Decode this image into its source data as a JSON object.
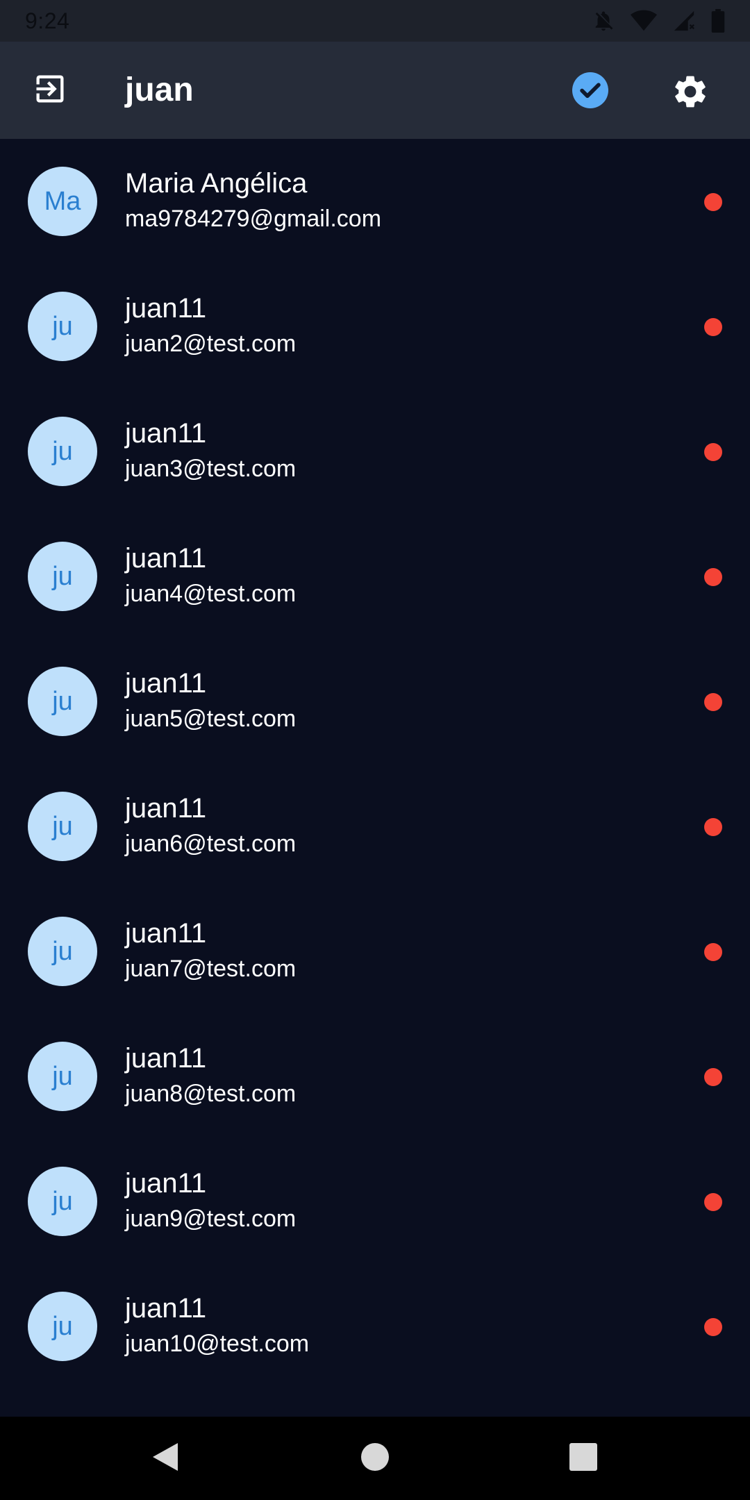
{
  "status_bar": {
    "time": "9:24",
    "icons": [
      "notifications-off-icon",
      "wifi-icon",
      "signal-icon",
      "battery-icon"
    ]
  },
  "app_bar": {
    "title": "juan",
    "left_icon": "logout-icon",
    "right_icons": [
      "verified-check-icon",
      "settings-gear-icon"
    ],
    "accent_color": "#5aabf5"
  },
  "contacts": [
    {
      "initials": "Ma",
      "name": "Maria Angélica",
      "email": "ma9784279@gmail.com",
      "status_color": "#f44336"
    },
    {
      "initials": "ju",
      "name": "juan11",
      "email": "juan2@test.com",
      "status_color": "#f44336"
    },
    {
      "initials": "ju",
      "name": "juan11",
      "email": "juan3@test.com",
      "status_color": "#f44336"
    },
    {
      "initials": "ju",
      "name": "juan11",
      "email": "juan4@test.com",
      "status_color": "#f44336"
    },
    {
      "initials": "ju",
      "name": "juan11",
      "email": "juan5@test.com",
      "status_color": "#f44336"
    },
    {
      "initials": "ju",
      "name": "juan11",
      "email": "juan6@test.com",
      "status_color": "#f44336"
    },
    {
      "initials": "ju",
      "name": "juan11",
      "email": "juan7@test.com",
      "status_color": "#f44336"
    },
    {
      "initials": "ju",
      "name": "juan11",
      "email": "juan8@test.com",
      "status_color": "#f44336"
    },
    {
      "initials": "ju",
      "name": "juan11",
      "email": "juan9@test.com",
      "status_color": "#f44336"
    },
    {
      "initials": "ju",
      "name": "juan11",
      "email": "juan10@test.com",
      "status_color": "#f44336"
    }
  ],
  "nav_bar": {
    "buttons": [
      "back-icon",
      "home-icon",
      "recents-icon"
    ]
  }
}
